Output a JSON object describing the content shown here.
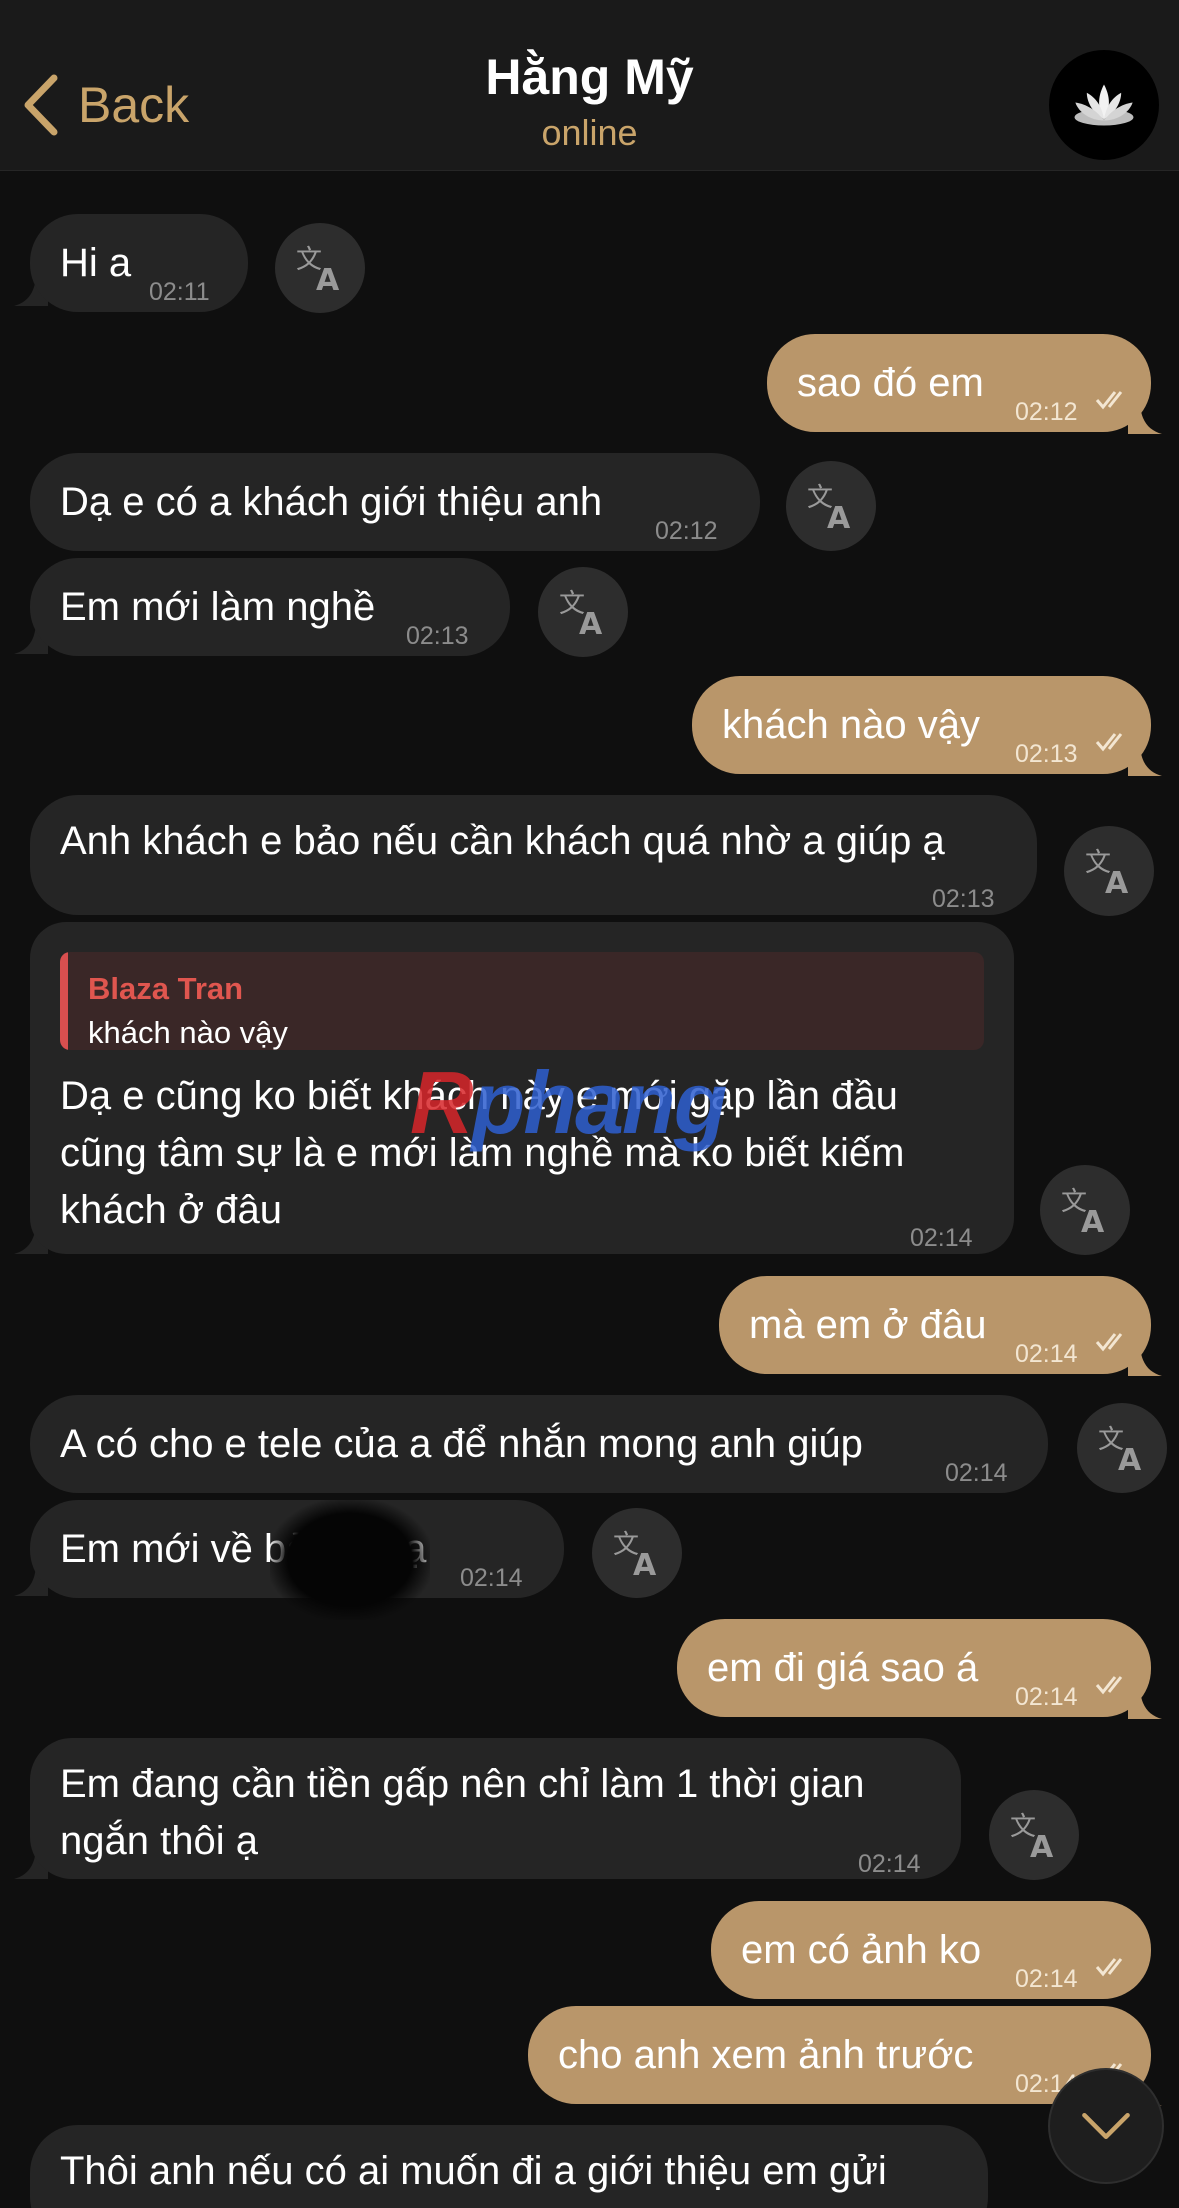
{
  "header": {
    "back_label": "Back",
    "contact_name": "Hằng Mỹ",
    "contact_status": "online",
    "avatar_icon": "lotus-avatar-icon"
  },
  "messages": [
    {
      "dir": "in",
      "text": "Hi a",
      "time": "02:11"
    },
    {
      "dir": "out",
      "text": "sao đó em",
      "time": "02:12"
    },
    {
      "dir": "in",
      "text": "Dạ e có a khách giới thiệu anh",
      "time": "02:12"
    },
    {
      "dir": "in",
      "text": "Em mới làm nghề",
      "time": "02:13"
    },
    {
      "dir": "out",
      "text": "khách nào vậy",
      "time": "02:13"
    },
    {
      "dir": "in",
      "text": "Anh khách e bảo nếu cần khách quá nhờ a giúp ạ",
      "time": "02:13"
    },
    {
      "dir": "in",
      "reply_to": {
        "author": "Blaza Tran",
        "text": "khách nào vậy"
      },
      "lines": [
        "Dạ  e cũng ko biết khách này e mới gặp lần đầu",
        "cũng tâm sự là e mới làm nghề mà ko biết kiếm",
        "khách ở đâu"
      ],
      "time": "02:14"
    },
    {
      "dir": "out",
      "text": "mà em ở đâu",
      "time": "02:14"
    },
    {
      "dir": "in",
      "text": "A có cho e tele của a để nhắn mong anh giúp",
      "time": "02:14"
    },
    {
      "dir": "in",
      "text": "Em mới về bảo lộc ạ",
      "time": "02:14"
    },
    {
      "dir": "out",
      "text": "em đi giá sao á",
      "time": "02:14"
    },
    {
      "dir": "in",
      "lines": [
        "Em đang cần tiền gấp nên chỉ làm 1 thời gian",
        "ngắn thôi ạ"
      ],
      "time": "02:14"
    },
    {
      "dir": "out",
      "text": "em có ảnh ko",
      "time": "02:14"
    },
    {
      "dir": "out",
      "text": "cho anh xem ảnh trước",
      "time": "02:14"
    },
    {
      "dir": "in",
      "text": "Thôi anh nếu có ai muốn đi a giới thiệu em gửi",
      "time": ""
    }
  ],
  "watermark": {
    "r": "R",
    "rest": "phang"
  },
  "colors": {
    "accent": "#c9a46a",
    "outgoing_bubble": "#b9966a",
    "incoming_bubble": "#252525",
    "background": "#0f0f0f",
    "quote_bar": "#d94f4f"
  }
}
